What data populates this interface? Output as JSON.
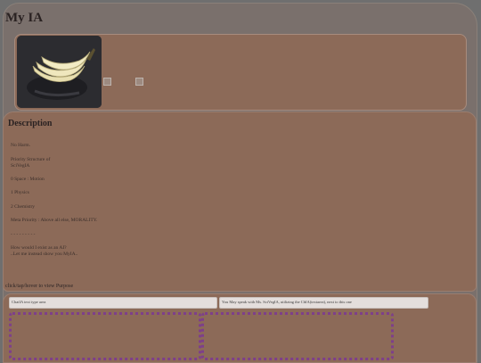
{
  "header": {
    "title": "My IA"
  },
  "description": {
    "heading": "Description",
    "lines": [
      "No Harm.",
      "Priority Structure of",
      "SciVegIA",
      "0 Space : Motion",
      "1 Physics",
      "2 Chemistry",
      "Meta Priority : Above all else, MORALITY.",
      "- - - - - - - - -",
      "How would I exist as an AI?",
      "..Let me instead show you MyIA.."
    ]
  },
  "hint": {
    "text": "click/tap/hover to view Purpose"
  },
  "chat": {
    "input_label": "ChatIA text type area",
    "info_label": "You May speak with Ms. SciVegIA, utilizing the ChIA(textarea), next to this one"
  },
  "colors": {
    "page_bg": "#6f6f6f",
    "panel_bg": "#8c6a58",
    "dotted_border": "#7e3f8a"
  },
  "icons": {
    "photo": "banana-photo",
    "broken": "broken-image-icon"
  }
}
